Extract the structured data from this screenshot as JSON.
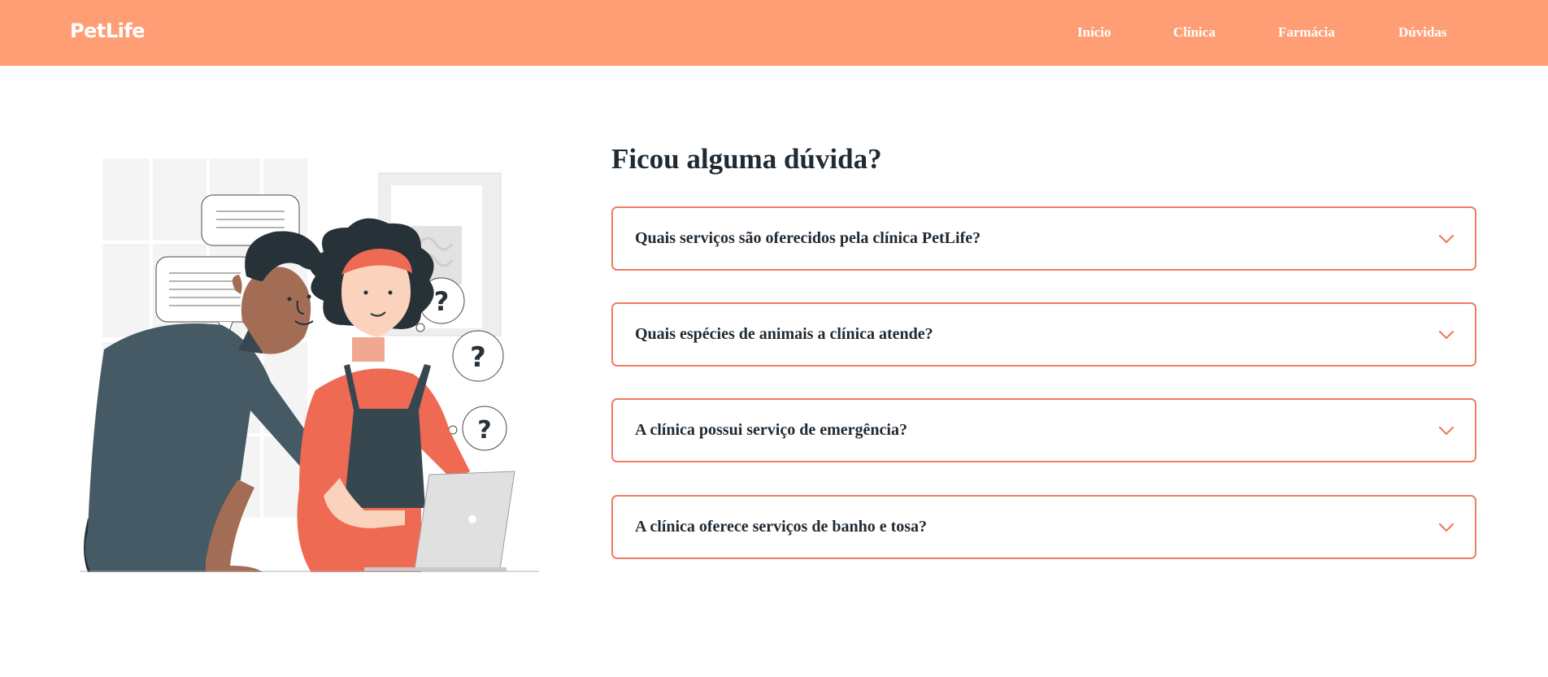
{
  "header": {
    "logo": "PetLife",
    "nav": [
      {
        "label": "Início"
      },
      {
        "label": "Clínica"
      },
      {
        "label": "Farmácia"
      },
      {
        "label": "Dúvidas"
      }
    ]
  },
  "faq": {
    "title": "Ficou alguma dúvida?",
    "items": [
      {
        "question": "Quais serviços são oferecidos pela clínica PetLife?",
        "icon": "chevron-down-icon"
      },
      {
        "question": "Quais espécies de animais a clínica atende?",
        "icon": "chevron-down-icon"
      },
      {
        "question": "A clínica possui serviço de emergência?",
        "icon": "chevron-down-icon"
      },
      {
        "question": "A clínica oferece serviços de banho e tosa?",
        "icon": "chevron-down-icon"
      }
    ]
  },
  "illustration": {
    "bubble_text_mark": "?"
  },
  "colors": {
    "header_bg": "#ff9e74",
    "accent": "#ef7b63",
    "text_dark": "#1f2a33",
    "white": "#ffffff"
  }
}
